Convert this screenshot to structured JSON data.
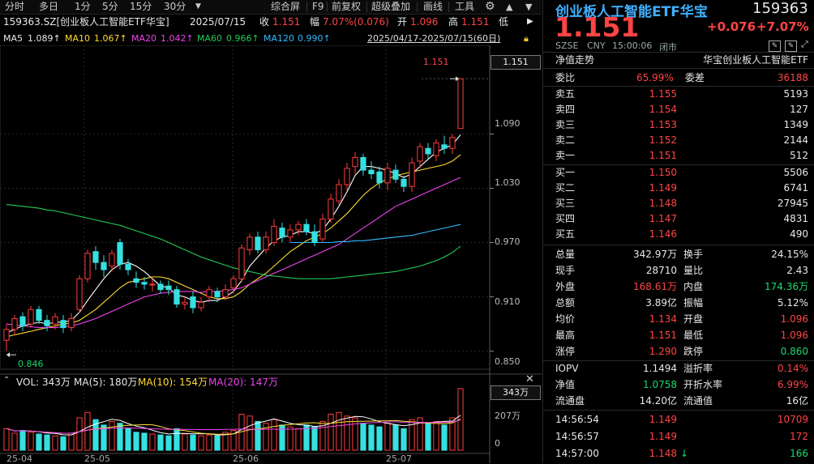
{
  "toolbar": {
    "period_tabs": [
      "分时",
      "多日",
      "1分",
      "5分",
      "15分",
      "30分"
    ],
    "more_icon": "caret-down-icon",
    "menu_items": [
      "综合屏",
      "F9",
      "前复权",
      "超级叠加",
      "画线",
      "工具"
    ],
    "settings_icon": "gear-icon"
  },
  "header": {
    "title": "159363.SZ[创业板人工智能ETF华宝]",
    "date": "2025/07/15",
    "close_label": "收",
    "close_value": "1.151",
    "change_label": "幅",
    "change_value": "7.07%(0.076)",
    "open_label": "开",
    "open_value": "1.096",
    "high_label": "高",
    "high_value": "1.151",
    "low_label": "低"
  },
  "ma": {
    "items": [
      {
        "label": "MA5",
        "value": "1.089↑",
        "color": "#ffffff"
      },
      {
        "label": "MA10",
        "value": "1.067↑",
        "color": "#ffdd33"
      },
      {
        "label": "MA20",
        "value": "1.042↑",
        "color": "#ee44ee"
      },
      {
        "label": "MA60",
        "value": "0.966↑",
        "color": "#22cc55"
      },
      {
        "label": "MA120",
        "value": "0.990↑",
        "color": "#33bbff"
      }
    ],
    "range": "2025/04/17-2025/07/15(60日)"
  },
  "volume": {
    "title": "VOL: 343万",
    "ma5": "MA(5): 180万",
    "ma10": "MA(10): 154万",
    "ma20": "MA(20): 147万",
    "last_box": "343万",
    "ticks": [
      "207万",
      "0"
    ]
  },
  "chart_data": {
    "type": "candlestick",
    "title": "159363.SZ 创业板人工智能ETF华宝",
    "ylim": [
      0.83,
      1.17
    ],
    "y_ticks": [
      1.09,
      1.03,
      0.97,
      0.91,
      0.85
    ],
    "y_tick_labels": [
      "1.090",
      "1.030",
      "0.970",
      "0.910",
      "0.850"
    ],
    "current_price_label": "1.151",
    "high_mark": "1.151",
    "low_mark": "0.846",
    "x_labels": [
      "25-04",
      "25-05",
      "25-06",
      "25-07"
    ],
    "candles": [
      [
        0.862,
        0.874,
        0.85,
        0.88
      ],
      [
        0.874,
        0.886,
        0.868,
        0.89
      ],
      [
        0.888,
        0.878,
        0.872,
        0.893
      ],
      [
        0.88,
        0.896,
        0.876,
        0.9
      ],
      [
        0.896,
        0.884,
        0.88,
        0.9
      ],
      [
        0.884,
        0.878,
        0.872,
        0.89
      ],
      [
        0.88,
        0.888,
        0.874,
        0.892
      ],
      [
        0.884,
        0.876,
        0.87,
        0.89
      ],
      [
        0.876,
        0.886,
        0.872,
        0.892
      ],
      [
        0.896,
        0.93,
        0.892,
        0.934
      ],
      [
        0.93,
        0.958,
        0.926,
        0.962
      ],
      [
        0.96,
        0.948,
        0.94,
        0.966
      ],
      [
        0.948,
        0.94,
        0.932,
        0.956
      ],
      [
        0.944,
        0.958,
        0.938,
        0.962
      ],
      [
        0.97,
        0.946,
        0.94,
        0.974
      ],
      [
        0.946,
        0.94,
        0.934,
        0.952
      ],
      [
        0.93,
        0.926,
        0.92,
        0.938
      ],
      [
        0.926,
        0.924,
        0.918,
        0.932
      ],
      [
        0.924,
        0.924,
        0.916,
        0.93
      ],
      [
        0.924,
        0.918,
        0.914,
        0.928
      ],
      [
        0.922,
        0.918,
        0.912,
        0.928
      ],
      [
        0.918,
        0.902,
        0.898,
        0.922
      ],
      [
        0.902,
        0.904,
        0.896,
        0.91
      ],
      [
        0.91,
        0.898,
        0.892,
        0.916
      ],
      [
        0.898,
        0.904,
        0.894,
        0.91
      ],
      [
        0.91,
        0.918,
        0.904,
        0.922
      ],
      [
        0.916,
        0.91,
        0.904,
        0.92
      ],
      [
        0.91,
        0.918,
        0.906,
        0.924
      ],
      [
        0.92,
        0.93,
        0.914,
        0.934
      ],
      [
        0.93,
        0.964,
        0.926,
        0.968
      ],
      [
        0.962,
        0.976,
        0.956,
        0.98
      ],
      [
        0.976,
        0.962,
        0.958,
        0.982
      ],
      [
        0.962,
        0.976,
        0.958,
        0.982
      ],
      [
        0.97,
        0.988,
        0.966,
        0.996
      ],
      [
        0.986,
        0.976,
        0.97,
        0.992
      ],
      [
        0.976,
        0.984,
        0.97,
        0.99
      ],
      [
        0.984,
        0.99,
        0.978,
        0.994
      ],
      [
        0.99,
        0.982,
        0.978,
        0.996
      ],
      [
        0.982,
        0.97,
        0.966,
        0.99
      ],
      [
        0.974,
        0.996,
        0.97,
        1.002
      ],
      [
        0.996,
        1.018,
        0.992,
        1.024
      ],
      [
        1.016,
        1.034,
        1.012,
        1.04
      ],
      [
        1.034,
        1.052,
        1.028,
        1.058
      ],
      [
        1.054,
        1.064,
        1.046,
        1.07
      ],
      [
        1.064,
        1.05,
        1.044,
        1.068
      ],
      [
        1.05,
        1.046,
        1.04,
        1.06
      ],
      [
        1.048,
        1.036,
        1.03,
        1.054
      ],
      [
        1.036,
        1.052,
        1.028,
        1.058
      ],
      [
        1.05,
        1.04,
        1.036,
        1.056
      ],
      [
        1.04,
        1.032,
        1.026,
        1.044
      ],
      [
        1.032,
        1.058,
        1.026,
        1.064
      ],
      [
        1.06,
        1.076,
        1.052,
        1.08
      ],
      [
        1.074,
        1.068,
        1.062,
        1.08
      ],
      [
        1.066,
        1.08,
        1.06,
        1.084
      ],
      [
        1.078,
        1.074,
        1.068,
        1.088
      ],
      [
        1.074,
        1.086,
        1.068,
        1.09
      ],
      [
        1.096,
        1.151,
        1.096,
        1.151
      ]
    ],
    "ma_series": [
      {
        "name": "MA5",
        "color": "#ffffff",
        "values": [
          0.87,
          0.874,
          0.878,
          0.88,
          0.882,
          0.88,
          0.882,
          0.882,
          0.884,
          0.893,
          0.906,
          0.918,
          0.93,
          0.94,
          0.946,
          0.948,
          0.944,
          0.938,
          0.93,
          0.922,
          0.92,
          0.912,
          0.91,
          0.906,
          0.904,
          0.906,
          0.906,
          0.91,
          0.916,
          0.928,
          0.944,
          0.954,
          0.964,
          0.972,
          0.976,
          0.978,
          0.982,
          0.982,
          0.98,
          0.984,
          0.996,
          1.01,
          1.026,
          1.044,
          1.054,
          1.054,
          1.052,
          1.05,
          1.046,
          1.042,
          1.046,
          1.054,
          1.062,
          1.07,
          1.074,
          1.078,
          1.089
        ]
      },
      {
        "name": "MA10",
        "color": "#ffdd33",
        "values": [
          0.866,
          0.868,
          0.87,
          0.872,
          0.874,
          0.876,
          0.878,
          0.88,
          0.881,
          0.884,
          0.89,
          0.896,
          0.904,
          0.912,
          0.92,
          0.926,
          0.928,
          0.93,
          0.932,
          0.932,
          0.93,
          0.926,
          0.922,
          0.918,
          0.914,
          0.91,
          0.908,
          0.908,
          0.91,
          0.916,
          0.924,
          0.93,
          0.936,
          0.944,
          0.952,
          0.96,
          0.966,
          0.972,
          0.976,
          0.98,
          0.986,
          0.994,
          1.002,
          1.012,
          1.022,
          1.03,
          1.036,
          1.04,
          1.044,
          1.046,
          1.048,
          1.05,
          1.052,
          1.054,
          1.056,
          1.06,
          1.067
        ]
      },
      {
        "name": "MA20",
        "color": "#ee44ee",
        "values": [
          0.88,
          0.879,
          0.878,
          0.877,
          0.876,
          0.876,
          0.876,
          0.877,
          0.878,
          0.88,
          0.883,
          0.886,
          0.89,
          0.894,
          0.898,
          0.902,
          0.906,
          0.91,
          0.912,
          0.914,
          0.915,
          0.916,
          0.916,
          0.916,
          0.915,
          0.916,
          0.916,
          0.917,
          0.918,
          0.92,
          0.924,
          0.928,
          0.932,
          0.936,
          0.94,
          0.944,
          0.948,
          0.952,
          0.956,
          0.96,
          0.964,
          0.968,
          0.974,
          0.98,
          0.986,
          0.992,
          0.998,
          1.004,
          1.01,
          1.014,
          1.018,
          1.022,
          1.026,
          1.03,
          1.034,
          1.038,
          1.042
        ]
      },
      {
        "name": "MA60",
        "color": "#22cc55",
        "values": [
          1.012,
          1.011,
          1.01,
          1.009,
          1.008,
          1.006,
          1.005,
          1.003,
          1.001,
          0.999,
          0.997,
          0.995,
          0.993,
          0.991,
          0.989,
          0.986,
          0.983,
          0.98,
          0.977,
          0.974,
          0.97,
          0.966,
          0.962,
          0.958,
          0.954,
          0.951,
          0.948,
          0.945,
          0.942,
          0.94,
          0.938,
          0.936,
          0.934,
          0.933,
          0.932,
          0.931,
          0.93,
          0.93,
          0.93,
          0.93,
          0.93,
          0.931,
          0.932,
          0.933,
          0.934,
          0.935,
          0.936,
          0.937,
          0.938,
          0.94,
          0.942,
          0.944,
          0.947,
          0.95,
          0.954,
          0.959,
          0.966
        ]
      },
      {
        "name": "MA120",
        "color": "#33bbff",
        "values": [
          null,
          null,
          null,
          null,
          null,
          null,
          null,
          null,
          null,
          null,
          null,
          null,
          null,
          null,
          null,
          null,
          null,
          null,
          null,
          null,
          null,
          null,
          null,
          null,
          null,
          null,
          null,
          null,
          null,
          null,
          null,
          null,
          null,
          null,
          null,
          0.97,
          0.97,
          0.97,
          0.97,
          0.97,
          0.97,
          0.971,
          0.971,
          0.972,
          0.972,
          0.973,
          0.974,
          0.975,
          0.976,
          0.977,
          0.978,
          0.98,
          0.982,
          0.984,
          0.986,
          0.988,
          0.99
        ]
      }
    ],
    "volume_values": [
      120,
      95,
      110,
      100,
      90,
      85,
      80,
      75,
      95,
      180,
      210,
      170,
      140,
      160,
      150,
      120,
      100,
      95,
      90,
      85,
      80,
      120,
      90,
      85,
      80,
      85,
      80,
      100,
      110,
      200,
      190,
      160,
      150,
      170,
      140,
      130,
      120,
      140,
      130,
      160,
      200,
      210,
      190,
      180,
      150,
      140,
      130,
      150,
      140,
      120,
      170,
      180,
      150,
      160,
      140,
      180,
      343
    ]
  },
  "right_panel": {
    "name": "创业板人工智能ETF华宝",
    "code": "159363",
    "price": "1.151",
    "change": "+0.076",
    "pct": "+7.07%",
    "market": "SZSE",
    "currency": "CNY",
    "time": "15:00:06",
    "status": "闭市",
    "trend_label": "净值走势",
    "fund_name": "华宝创业板人工智能ETF",
    "weibi_label": "委比",
    "weibi_value": "65.99%",
    "weicha_label": "委差",
    "weicha_value": "36188",
    "asks": [
      {
        "label": "卖五",
        "price": "1.155",
        "vol": "5193"
      },
      {
        "label": "卖四",
        "price": "1.154",
        "vol": "127"
      },
      {
        "label": "卖三",
        "price": "1.153",
        "vol": "1349"
      },
      {
        "label": "卖二",
        "price": "1.152",
        "vol": "2144"
      },
      {
        "label": "卖一",
        "price": "1.151",
        "vol": "512"
      }
    ],
    "bids": [
      {
        "label": "买一",
        "price": "1.150",
        "vol": "5506"
      },
      {
        "label": "买二",
        "price": "1.149",
        "vol": "6741"
      },
      {
        "label": "买三",
        "price": "1.148",
        "vol": "27945"
      },
      {
        "label": "买四",
        "price": "1.147",
        "vol": "4831"
      },
      {
        "label": "买五",
        "price": "1.146",
        "vol": "490"
      }
    ],
    "stats": [
      {
        "l1": "总量",
        "v1": "342.97万",
        "c1": "white",
        "l2": "换手",
        "v2": "24.15%",
        "c2": "white"
      },
      {
        "l1": "现手",
        "v1": "28710",
        "c1": "white",
        "l2": "量比",
        "v2": "2.43",
        "c2": "white"
      },
      {
        "l1": "外盘",
        "v1": "168.61万",
        "c1": "red",
        "l2": "内盘",
        "v2": "174.36万",
        "c2": "green"
      },
      {
        "l1": "总额",
        "v1": "3.89亿",
        "c1": "white",
        "l2": "振幅",
        "v2": "5.12%",
        "c2": "white"
      },
      {
        "l1": "均价",
        "v1": "1.134",
        "c1": "red",
        "l2": "开盘",
        "v2": "1.096",
        "c2": "red"
      },
      {
        "l1": "最高",
        "v1": "1.151",
        "c1": "red",
        "l2": "最低",
        "v2": "1.096",
        "c2": "red"
      },
      {
        "l1": "涨停",
        "v1": "1.290",
        "c1": "red",
        "l2": "跌停",
        "v2": "0.860",
        "c2": "green"
      }
    ],
    "stats2": [
      {
        "l1": "IOPV",
        "v1": "1.1494",
        "c1": "white",
        "l2": "溢折率",
        "v2": "0.14%",
        "c2": "red"
      },
      {
        "l1": "净值",
        "v1": "1.0758",
        "c1": "green",
        "l2": "开折水率",
        "v2": "6.99%",
        "c2": "red"
      },
      {
        "l1": "流通盘",
        "v1": "14.20亿",
        "c1": "white",
        "l2": "流通值",
        "v2": "16亿",
        "c2": "white"
      }
    ],
    "ticks": [
      {
        "time": "14:56:54",
        "price": "1.149",
        "vol": "10709",
        "vc": "red"
      },
      {
        "time": "14:56:57",
        "price": "1.149",
        "vol": "172",
        "vc": "red"
      },
      {
        "time": "14:57:00",
        "price": "1.148",
        "arrow": "↓",
        "vol": "166",
        "vc": "green"
      }
    ]
  }
}
